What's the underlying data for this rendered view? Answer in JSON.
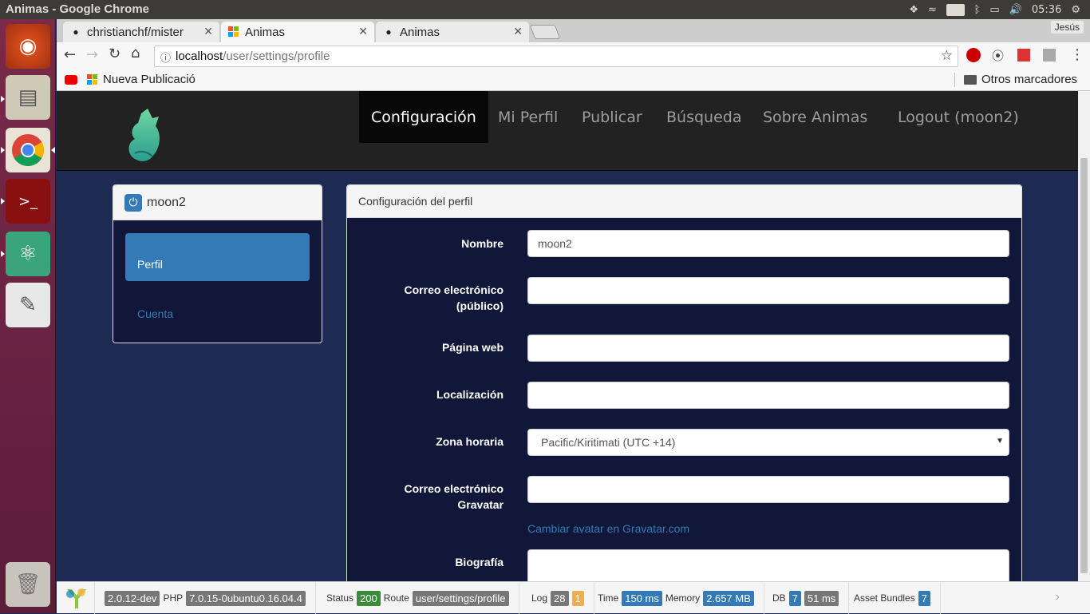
{
  "os": {
    "window_title": "Animas - Google Chrome",
    "keyboard_layout": "Es",
    "clock": "05:36",
    "user": "Jesús"
  },
  "browser": {
    "tabs": [
      {
        "title": "christianchf/mister",
        "icon": "github-icon"
      },
      {
        "title": "Animas",
        "icon": "animas-favicon-icon"
      },
      {
        "title": "Animas",
        "icon": "github-icon"
      }
    ],
    "url_host": "localhost",
    "url_path": "/user/settings/profile",
    "bookmarks": {
      "item1": "Nueva Publicació",
      "other": "Otros marcadores"
    }
  },
  "navbar": {
    "links": [
      "Configuración",
      "Mi Perfil",
      "Publicar",
      "Búsqueda",
      "Sobre Animas",
      "Logout (moon2)"
    ]
  },
  "sidebar": {
    "username": "moon2",
    "items": [
      "Perfil",
      "Cuenta"
    ]
  },
  "profile_form": {
    "heading": "Configuración del perfil",
    "fields": {
      "nombre": {
        "label": "Nombre",
        "value": "moon2"
      },
      "correo_publico": {
        "label_line1": "Correo electrónico",
        "label_line2": "(público)",
        "value": ""
      },
      "pagina_web": {
        "label": "Página web",
        "value": ""
      },
      "localizacion": {
        "label": "Localización",
        "value": ""
      },
      "zona_horaria": {
        "label": "Zona horaria",
        "value": "Pacific/Kiritimati (UTC +14)"
      },
      "gravatar": {
        "label_line1": "Correo electrónico",
        "label_line2": "Gravatar",
        "value": "",
        "link": "Cambiar avatar en Gravatar.com"
      },
      "biografia": {
        "label": "Biografía",
        "value": ""
      }
    }
  },
  "debugbar": {
    "yii_version": "2.0.12-dev",
    "php_label": "PHP",
    "php_version": "7.0.15-0ubuntu0.16.04.4",
    "status_label": "Status",
    "status": "200",
    "route_label": "Route",
    "route": "user/settings/profile",
    "log_label": "Log",
    "log_count": "28",
    "log_warn": "1",
    "time_label": "Time",
    "time": "150 ms",
    "memory_label": "Memory",
    "memory": "2.657 MB",
    "db_label": "DB",
    "db_count": "7",
    "db_time": "51 ms",
    "assets_label": "Asset Bundles",
    "assets": "7"
  },
  "colors": {
    "accent": "#337ab7",
    "navbar": "#222222",
    "page_bg": "#1d2a52",
    "panel_bg": "#111738"
  }
}
